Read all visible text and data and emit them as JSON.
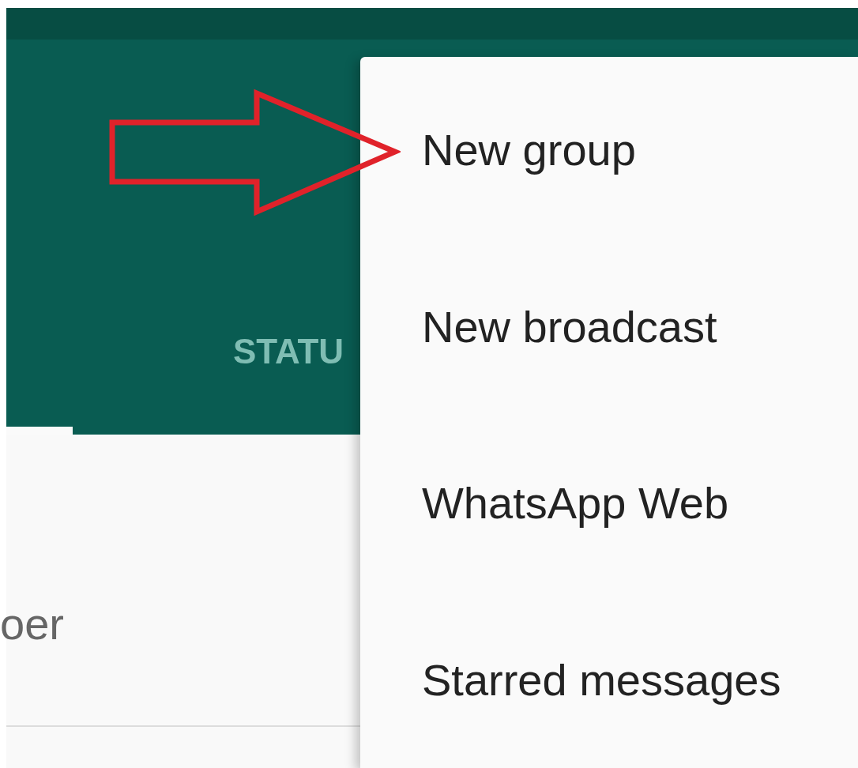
{
  "header": {
    "tabs": [
      {
        "label": "STATU",
        "selected": false
      }
    ]
  },
  "chat_list": {
    "rows": [
      {
        "text": "oer"
      }
    ]
  },
  "menu": {
    "items": [
      {
        "label": "New group",
        "highlighted": true
      },
      {
        "label": "New broadcast",
        "highlighted": false
      },
      {
        "label": "WhatsApp Web",
        "highlighted": false
      },
      {
        "label": "Starred messages",
        "highlighted": false
      }
    ]
  }
}
